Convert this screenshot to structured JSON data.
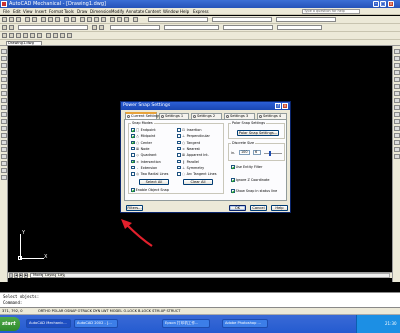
{
  "app": {
    "title": "AutoCAD Mechanical - [Drawing1.dwg]"
  },
  "menu": {
    "items": [
      "File",
      "Edit",
      "View",
      "Insert",
      "Format",
      "Tools",
      "Draw",
      "Dimension",
      "Modify",
      "Annotate",
      "Content",
      "Window",
      "Help",
      "Express"
    ],
    "help_placeholder": "Type a question for help"
  },
  "document_tab": {
    "label": "Drawing1.dwg"
  },
  "layout_tabs": {
    "nav": [
      "|◄",
      "◄",
      "►",
      "►|"
    ],
    "tabs": [
      "Model",
      "Layout1",
      "Layout2"
    ]
  },
  "ucs": {
    "x_label": "X",
    "y_label": "Y"
  },
  "command": {
    "line1": "Select objects:",
    "line2": "Command:"
  },
  "statusbar": {
    "coords": "371, 792, 0",
    "toggles": "ORTHO  POLAR  OSNAP  OTRACK  DYN  LWT  MODEL  O-LOCK  B-LOCK  STM-UP  STRUCT"
  },
  "taskbar": {
    "start": "start",
    "tasks": [
      "AutoCAD Mechanic...",
      "AutoCAD 2002 - [...",
      "Epson 打印机工作...",
      "Adobe Photoshop ..."
    ],
    "clock": "21:30"
  },
  "dialog": {
    "title": "Power Snap Settings",
    "help_glyph": "?",
    "close_glyph": "×",
    "tabs": [
      "Current Settings",
      "Settings 1",
      "Settings 2",
      "Settings 3",
      "Settings 4"
    ],
    "snap_modes_label": "Snap Modes",
    "snap_modes_left": [
      {
        "label": "Endpoint",
        "checked": true,
        "symbol": "□"
      },
      {
        "label": "Midpoint",
        "checked": true,
        "symbol": "△"
      },
      {
        "label": "Center",
        "checked": true,
        "symbol": "○"
      },
      {
        "label": "Node",
        "checked": false,
        "symbol": "⊠"
      },
      {
        "label": "Quadrant",
        "checked": false,
        "symbol": "◇"
      },
      {
        "label": "Intersection",
        "checked": true,
        "symbol": "×"
      },
      {
        "label": "Extension",
        "checked": false,
        "symbol": "-"
      },
      {
        "label": "Two Radial Lines",
        "checked": false,
        "symbol": "◎"
      }
    ],
    "snap_modes_right": [
      {
        "label": "Insertion",
        "checked": false,
        "symbol": "⊡"
      },
      {
        "label": "Perpendicular",
        "checked": false,
        "symbol": "⊥"
      },
      {
        "label": "Tangent",
        "checked": false,
        "symbol": "○"
      },
      {
        "label": "Nearest",
        "checked": false,
        "symbol": "⧖"
      },
      {
        "label": "Apparent Int.",
        "checked": false,
        "symbol": "⊠"
      },
      {
        "label": "Parallel",
        "checked": false,
        "symbol": "∥"
      },
      {
        "label": "Symmetry",
        "checked": false,
        "symbol": "⟂"
      },
      {
        "label": "Arc Tangent Lines",
        "checked": false,
        "symbol": "◌"
      }
    ],
    "select_all": "Select All",
    "clear_all": "Clear All",
    "enable_object_snap": {
      "label": "Enable Object Snap",
      "checked": true
    },
    "polar_snap_label": "Polar Snap Settings",
    "polar_snap_button": "Polar Snap Settings...",
    "discrete_size_label": "Discrete Size",
    "discrete_unit": "in.",
    "discrete_value": "100",
    "discrete_count": "6",
    "use_entity_filter": {
      "label": "Use Entity Filter",
      "checked": true
    },
    "ignore_z": {
      "label": "Ignore Z Coordinate",
      "checked": true
    },
    "show_snap_status": {
      "label": "Show Snap in status line",
      "checked": true
    },
    "filters_button": "Filters...",
    "ok_button": "OK",
    "cancel_button": "Cancel",
    "help_button": "Help"
  },
  "colors": {
    "arrow": "#e2202c",
    "titlebar": "#2552b8",
    "canvas": "#000000"
  }
}
